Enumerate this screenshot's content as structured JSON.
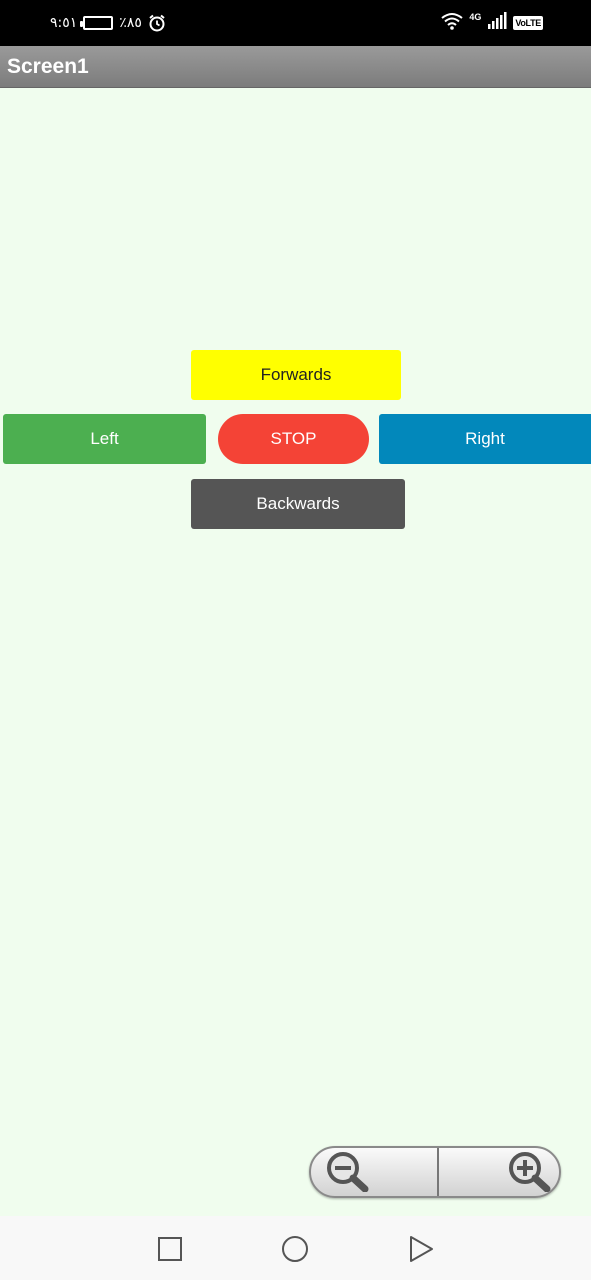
{
  "status_bar": {
    "time": "٩:٥١",
    "battery_percent": "٪٨٥",
    "battery_level": 0.85,
    "network_type": "4G",
    "volte": "VoLTE",
    "icons": [
      "battery-icon",
      "alarm-icon",
      "wifi-icon",
      "signal-icon",
      "volte-icon"
    ]
  },
  "app": {
    "title": "Screen1",
    "title_bar_color": "#8a8a8a",
    "background_color": "#f0fdee"
  },
  "controls": {
    "forwards": {
      "label": "Forwards",
      "color": "#ffff00"
    },
    "left": {
      "label": "Left",
      "color": "#4caf50"
    },
    "stop": {
      "label": "STOP",
      "color": "#f44336"
    },
    "right": {
      "label": "Right",
      "color": "#0288bb"
    },
    "backwards": {
      "label": "Backwards",
      "color": "#555555"
    }
  },
  "zoom": {
    "icons": [
      "zoom-out-icon",
      "zoom-in-icon"
    ]
  },
  "navigation": {
    "icons": [
      "recents-icon",
      "home-icon",
      "back-icon"
    ]
  }
}
